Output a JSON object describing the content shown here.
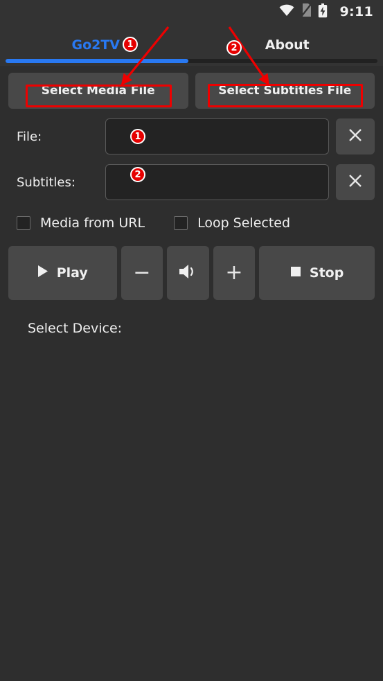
{
  "statusbar": {
    "time": "9:11",
    "icons": [
      "wifi-icon",
      "no-sim-icon",
      "battery-charging-icon"
    ]
  },
  "tabs": [
    {
      "label": "Go2TV",
      "active": true
    },
    {
      "label": "About",
      "active": false
    }
  ],
  "toolbar": {
    "select_media_label": "Select Media File",
    "select_subtitles_label": "Select Subtitles File"
  },
  "fields": [
    {
      "label": "File:",
      "value": "",
      "placeholder": "",
      "clear_icon": "close-icon"
    },
    {
      "label": "Subtitles:",
      "value": "",
      "placeholder": "",
      "clear_icon": "close-icon"
    }
  ],
  "checkboxes": [
    {
      "label": "Media from URL",
      "checked": false
    },
    {
      "label": "Loop Selected",
      "checked": false
    }
  ],
  "controls": {
    "play_label": "Play",
    "volume_down_label": "−",
    "volume_icon_label": "volume-icon",
    "volume_up_label": "+",
    "stop_label": "Stop"
  },
  "device": {
    "select_device_label": "Select Device:"
  },
  "annotations": {
    "badges": [
      {
        "id": "1",
        "target": "go2tv-tab"
      },
      {
        "id": "2",
        "target": "about-tab"
      },
      {
        "id": "1",
        "target": "file-input"
      },
      {
        "id": "2",
        "target": "subtitles-input"
      }
    ],
    "highlight_color": "#ee0000",
    "arrow_color": "#ee0000"
  },
  "colors": {
    "background": "#2e2e2e",
    "surface": "#333333",
    "button": "#484848",
    "input": "#232323",
    "accent": "#2979f2",
    "annotation": "#ee0000",
    "text": "#efefef"
  }
}
